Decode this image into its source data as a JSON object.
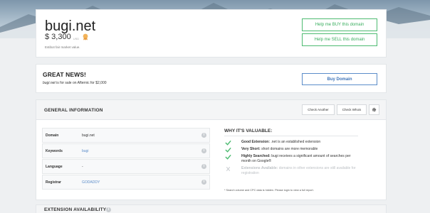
{
  "domain": {
    "name": "bugi.net",
    "price": "$ 3,300",
    "price_unit": "USD",
    "caption": "Estibot fair market value.",
    "buy_button": "Help me BUY this domain",
    "sell_button": "Help me SELL this domain"
  },
  "news": {
    "title": "GREAT NEWS!",
    "domain_italic": "bugi.net",
    "text_rest": " is for sale on Afternic for $2,000",
    "buy_button": "Buy Domain"
  },
  "general": {
    "title": "GENERAL INFORMATION",
    "check_another": "Check Another",
    "check_whois": "Check Whois",
    "rows": [
      {
        "label": "Domain",
        "value": "bugi.net"
      },
      {
        "label": "Keywords",
        "value": "bugi"
      },
      {
        "label": "Language",
        "value": "-"
      },
      {
        "label": "Registrar",
        "value": "GODADDY"
      }
    ]
  },
  "why": {
    "title": "WHY IT'S VALUABLE:",
    "items": [
      {
        "bold": "Good Extension:",
        "text": " .net is an established extension"
      },
      {
        "bold": "Very Short:",
        "text": " short domains are more memorable"
      },
      {
        "bold": "Highly Searched:",
        "text": " bugi receives a significant amount of searches per month on Google®"
      },
      {
        "bold": "Extensions Available:",
        "text": " domains in other extensions are still available for registration"
      }
    ],
    "note": "* Search volume and CPC data is hidden. Please login to view a full report."
  },
  "extension": {
    "title": "EXTENSION AVAILABILITY"
  },
  "colors": {
    "green": "#4dbb71",
    "blue": "#5b8cc9",
    "muted": "#bdc1c5"
  }
}
